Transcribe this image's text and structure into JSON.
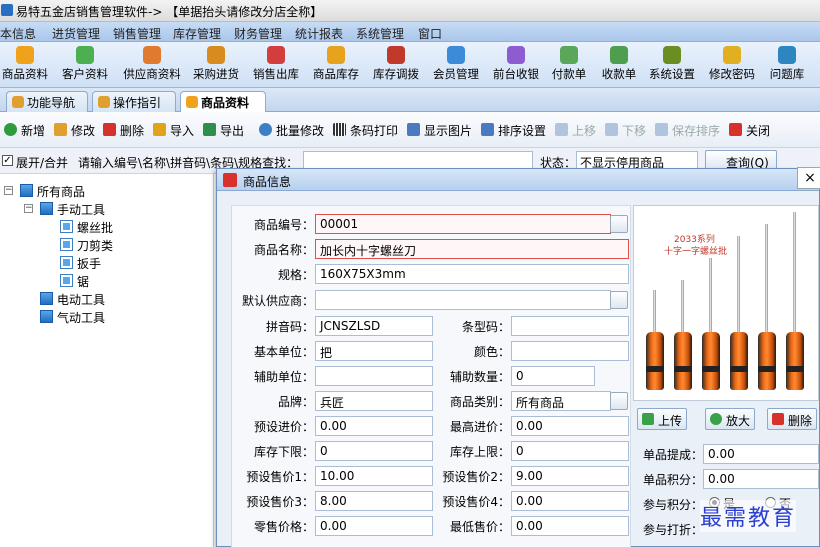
{
  "window": {
    "title": "易特五金店销售管理软件-> 【单据抬头请修改分店全称】"
  },
  "menu": [
    "本信息",
    "进货管理",
    "销售管理",
    "库存管理",
    "财务管理",
    "统计报表",
    "系统管理",
    "窗口"
  ],
  "toolbar": [
    {
      "label": "商品资料",
      "icon": "product-icon",
      "color": "#f0a21c"
    },
    {
      "label": "客户资料",
      "icon": "customer-icon",
      "color": "#4caf50"
    },
    {
      "label": "供应商资料",
      "icon": "supplier-icon",
      "color": "#e07a2e"
    },
    {
      "label": "采购进货",
      "icon": "purchase-icon",
      "color": "#d88c1e"
    },
    {
      "label": "销售出库",
      "icon": "sales-icon",
      "color": "#d43d3d"
    },
    {
      "label": "商品库存",
      "icon": "stock-icon",
      "color": "#e7a31d"
    },
    {
      "label": "库存调拨",
      "icon": "transfer-icon",
      "color": "#c0392b"
    },
    {
      "label": "会员管理",
      "icon": "member-icon",
      "color": "#3b8bd8"
    },
    {
      "label": "前台收银",
      "icon": "cashier-icon",
      "color": "#8e5bd0"
    },
    {
      "label": "付款单",
      "icon": "payment-icon",
      "color": "#5aa65a"
    },
    {
      "label": "收款单",
      "icon": "receipt-icon",
      "color": "#4f9e4f"
    },
    {
      "label": "系统设置",
      "icon": "settings-icon",
      "color": "#6b8e23"
    },
    {
      "label": "修改密码",
      "icon": "password-icon",
      "color": "#e0b020"
    },
    {
      "label": "问题库",
      "icon": "faq-icon",
      "color": "#2e86c1"
    }
  ],
  "tabs": [
    {
      "label": "功能导航",
      "active": false
    },
    {
      "label": "操作指引",
      "active": false
    },
    {
      "label": "商品资料",
      "active": true
    }
  ],
  "actions": [
    {
      "label": "新增",
      "color": "#2e9c3a",
      "disabled": false
    },
    {
      "label": "修改",
      "color": "#e0a030",
      "disabled": false
    },
    {
      "label": "删除",
      "color": "#d6322c",
      "disabled": false
    },
    {
      "label": "导入",
      "color": "#e3a21c",
      "disabled": false
    },
    {
      "label": "导出",
      "color": "#2f8f4a",
      "disabled": false
    },
    {
      "label": "批量修改",
      "color": "#3d7fc4",
      "disabled": false
    },
    {
      "label": "条码打印",
      "color": "#555555",
      "disabled": false
    },
    {
      "label": "显示图片",
      "color": "#4a7bc0",
      "disabled": false
    },
    {
      "label": "排序设置",
      "color": "#4a7bc0",
      "disabled": false
    },
    {
      "label": "上移",
      "color": "#b0c4de",
      "disabled": true
    },
    {
      "label": "下移",
      "color": "#b0c4de",
      "disabled": true
    },
    {
      "label": "保存排序",
      "color": "#b0c4de",
      "disabled": true
    },
    {
      "label": "关闭",
      "color": "#d6322c",
      "disabled": false
    }
  ],
  "filter": {
    "checkbox_label": "展开/合并",
    "hint": "请输入编号\\名称\\拼音码\\条码\\规格查找：",
    "status_label": "状态：",
    "status_value": "不显示停用商品",
    "query_label": "查询(Q)"
  },
  "tree": {
    "root": "所有商品",
    "children": [
      {
        "label": "手动工具",
        "children": [
          "螺丝批",
          "刀剪类",
          "扳手",
          "锯"
        ]
      },
      {
        "label": "电动工具",
        "children": []
      },
      {
        "label": "气动工具",
        "children": []
      }
    ]
  },
  "dialog": {
    "title": "商品信息",
    "close": "×",
    "fields": {
      "code": {
        "label": "商品编号：",
        "value": "00001"
      },
      "name": {
        "label": "商品名称：",
        "value": "加长内十字螺丝刀"
      },
      "spec": {
        "label": "规格：",
        "value": "160X75X3mm"
      },
      "supplier": {
        "label": "默认供应商：",
        "value": ""
      },
      "pinyin": {
        "label": "拼音码：",
        "value": "JCNSZLSD"
      },
      "barcode": {
        "label": "条型码：",
        "value": ""
      },
      "unit": {
        "label": "基本单位：",
        "value": "把"
      },
      "color": {
        "label": "颜色：",
        "value": ""
      },
      "aux_unit": {
        "label": "辅助单位：",
        "value": ""
      },
      "aux_qty": {
        "label": "辅助数量：",
        "value": "0"
      },
      "brand": {
        "label": "品牌：",
        "value": "兵匠"
      },
      "category": {
        "label": "商品类别：",
        "value": "所有商品"
      },
      "preset_cost": {
        "label": "预设进价：",
        "value": "0.00"
      },
      "max_cost": {
        "label": "最高进价：",
        "value": "0.00"
      },
      "stock_min": {
        "label": "库存下限：",
        "value": "0"
      },
      "stock_max": {
        "label": "库存上限：",
        "value": "0"
      },
      "price1": {
        "label": "预设售价1：",
        "value": "10.00"
      },
      "price2": {
        "label": "预设售价2：",
        "value": "9.00"
      },
      "price3": {
        "label": "预设售价3：",
        "value": "8.00"
      },
      "price4": {
        "label": "预设售价4：",
        "value": "0.00"
      },
      "retail": {
        "label": "零售价格：",
        "value": "0.00"
      },
      "min_price": {
        "label": "最低售价：",
        "value": "0.00"
      }
    },
    "image_caption1": "2033系列",
    "image_caption2": "十字一字螺丝批",
    "image_buttons": [
      "上传",
      "放大",
      "删除"
    ],
    "right_fields": {
      "commission": {
        "label": "单品提成：",
        "value": "0.00"
      },
      "points": {
        "label": "单品积分：",
        "value": "0.00"
      },
      "join_points": {
        "label": "参与积分：",
        "options": [
          "是",
          "否"
        ],
        "selected": "是"
      },
      "join_discount": {
        "label": "参与打折："
      }
    }
  },
  "watermark": "最需教育"
}
